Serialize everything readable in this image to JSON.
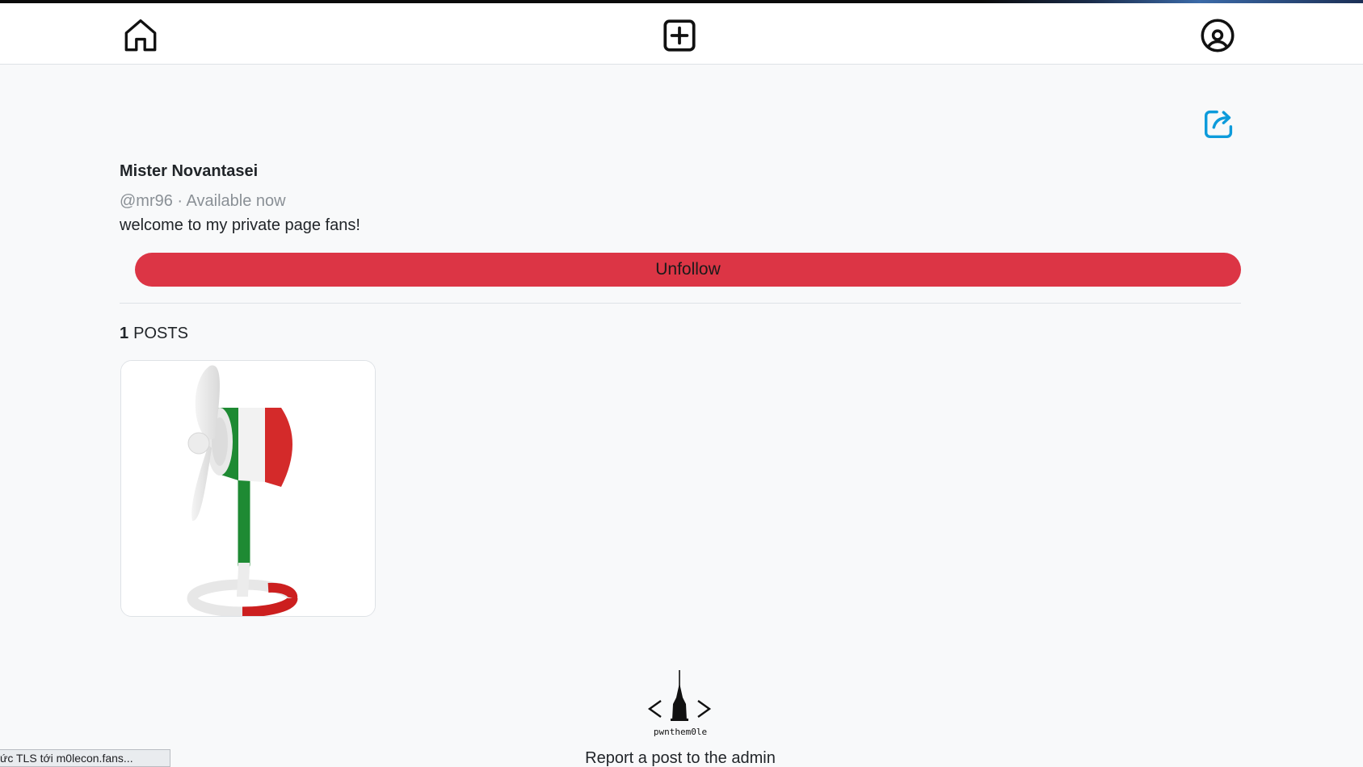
{
  "nav": {
    "home_icon": "home-icon",
    "add_icon": "plus-square-icon",
    "profile_icon": "user-circle-icon"
  },
  "profile": {
    "name": "Mister Novantasei",
    "handle": "@mr96",
    "separator": " · ",
    "status": "Available now",
    "bio": "welcome to my private page fans!",
    "unfollow_label": "Unfollow",
    "share_icon": "share-icon"
  },
  "posts": {
    "count": "1",
    "label": "POSTS",
    "items": [
      {
        "image": "italian-flag-fan-image"
      }
    ]
  },
  "footer": {
    "logo_text": "pwnthem0le",
    "report_label": "Report a post to the admin"
  },
  "status_bar": {
    "text": "ức TLS tới m0lecon.fans..."
  },
  "colors": {
    "accent": "#0d9bdb",
    "danger": "#dc3545",
    "background": "#f8f9fa",
    "muted": "#8a9096"
  }
}
